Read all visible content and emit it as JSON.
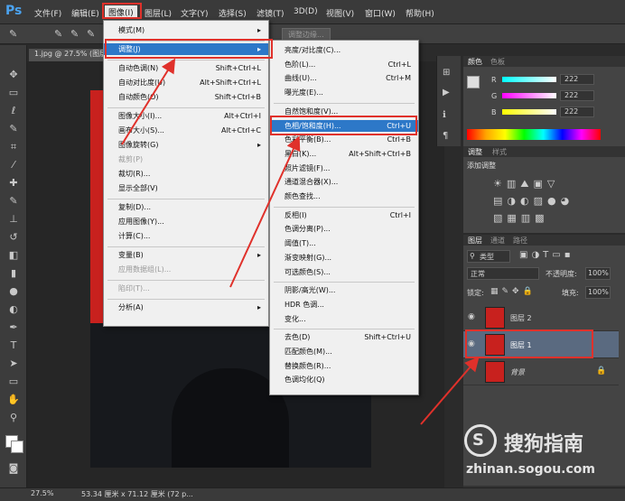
{
  "app": {
    "logo": "Ps"
  },
  "menubar": {
    "items": [
      {
        "label": "文件(F)"
      },
      {
        "label": "编辑(E)"
      },
      {
        "label": "图像(I)"
      },
      {
        "label": "图层(L)"
      },
      {
        "label": "文字(Y)"
      },
      {
        "label": "选择(S)"
      },
      {
        "label": "滤镜(T)"
      },
      {
        "label": "3D(D)"
      },
      {
        "label": "视图(V)"
      },
      {
        "label": "窗口(W)"
      },
      {
        "label": "帮助(H)"
      }
    ]
  },
  "options_bar": {
    "refine_edge": "调整边缘..."
  },
  "document": {
    "tab_title": "1.jpg @ 27.5% (图层 1"
  },
  "image_menu": {
    "items": [
      {
        "label": "模式(M)",
        "shortcut": "",
        "submenu": true
      },
      {
        "label": "调整(J)",
        "shortcut": "",
        "submenu": true,
        "highlighted": true
      },
      {
        "label": "自动色调(N)",
        "shortcut": "Shift+Ctrl+L"
      },
      {
        "label": "自动对比度(U)",
        "shortcut": "Alt+Shift+Ctrl+L"
      },
      {
        "label": "自动颜色(O)",
        "shortcut": "Shift+Ctrl+B"
      },
      {
        "label": "图像大小(I)...",
        "shortcut": "Alt+Ctrl+I"
      },
      {
        "label": "画布大小(S)...",
        "shortcut": "Alt+Ctrl+C"
      },
      {
        "label": "图像旋转(G)",
        "shortcut": "",
        "submenu": true
      },
      {
        "label": "裁剪(P)",
        "shortcut": "",
        "disabled": true
      },
      {
        "label": "裁切(R)...",
        "shortcut": ""
      },
      {
        "label": "显示全部(V)",
        "shortcut": ""
      },
      {
        "label": "复制(D)...",
        "shortcut": ""
      },
      {
        "label": "应用图像(Y)...",
        "shortcut": ""
      },
      {
        "label": "计算(C)...",
        "shortcut": ""
      },
      {
        "label": "变量(B)",
        "shortcut": "",
        "submenu": true
      },
      {
        "label": "应用数据组(L)...",
        "shortcut": "",
        "disabled": true
      },
      {
        "label": "陷印(T)...",
        "shortcut": "",
        "disabled": true
      },
      {
        "label": "分析(A)",
        "shortcut": "",
        "submenu": true
      }
    ]
  },
  "adjust_menu": {
    "items": [
      {
        "label": "亮度/对比度(C)...",
        "shortcut": ""
      },
      {
        "label": "色阶(L)...",
        "shortcut": "Ctrl+L"
      },
      {
        "label": "曲线(U)...",
        "shortcut": "Ctrl+M"
      },
      {
        "label": "曝光度(E)...",
        "shortcut": ""
      },
      {
        "label": "自然饱和度(V)...",
        "shortcut": ""
      },
      {
        "label": "色相/饱和度(H)...",
        "shortcut": "Ctrl+U",
        "highlighted": true
      },
      {
        "label": "色彩平衡(B)...",
        "shortcut": "Ctrl+B"
      },
      {
        "label": "黑白(K)...",
        "shortcut": "Alt+Shift+Ctrl+B"
      },
      {
        "label": "照片滤镜(F)...",
        "shortcut": ""
      },
      {
        "label": "通道混合器(X)...",
        "shortcut": ""
      },
      {
        "label": "颜色查找...",
        "shortcut": ""
      },
      {
        "label": "反相(I)",
        "shortcut": "Ctrl+I"
      },
      {
        "label": "色调分离(P)...",
        "shortcut": ""
      },
      {
        "label": "阈值(T)...",
        "shortcut": ""
      },
      {
        "label": "渐变映射(G)...",
        "shortcut": ""
      },
      {
        "label": "可选颜色(S)...",
        "shortcut": ""
      },
      {
        "label": "阴影/高光(W)...",
        "shortcut": ""
      },
      {
        "label": "HDR 色调...",
        "shortcut": ""
      },
      {
        "label": "变化...",
        "shortcut": ""
      },
      {
        "label": "去色(D)",
        "shortcut": "Shift+Ctrl+U"
      },
      {
        "label": "匹配颜色(M)...",
        "shortcut": ""
      },
      {
        "label": "替换颜色(R)...",
        "shortcut": ""
      },
      {
        "label": "色调均化(Q)",
        "shortcut": ""
      }
    ]
  },
  "color_panel": {
    "tabs": [
      "颜色",
      "色板"
    ],
    "r_label": "R",
    "g_label": "G",
    "b_label": "B",
    "r": "222",
    "g": "222",
    "b": "222"
  },
  "adjust_panel": {
    "tabs": [
      "调整",
      "样式"
    ],
    "title": "添加调整"
  },
  "layers_panel": {
    "tabs": [
      "图层",
      "通道",
      "路径"
    ],
    "filter": "类型",
    "blend_mode": "正常",
    "opacity_label": "不透明度:",
    "opacity": "100%",
    "lock_label": "锁定:",
    "fill_label": "填充:",
    "fill": "100%",
    "layers": [
      {
        "name": "图层 2"
      },
      {
        "name": "图层 1",
        "selected": true
      },
      {
        "name": "背景",
        "locked": true
      }
    ]
  },
  "statusbar": {
    "zoom": "27.5%",
    "doc_info": "53.34 厘米 x 71.12 厘米 (72 p..."
  },
  "watermark": {
    "brand": "搜狗指南",
    "url": "zhinan.sogou.com"
  }
}
